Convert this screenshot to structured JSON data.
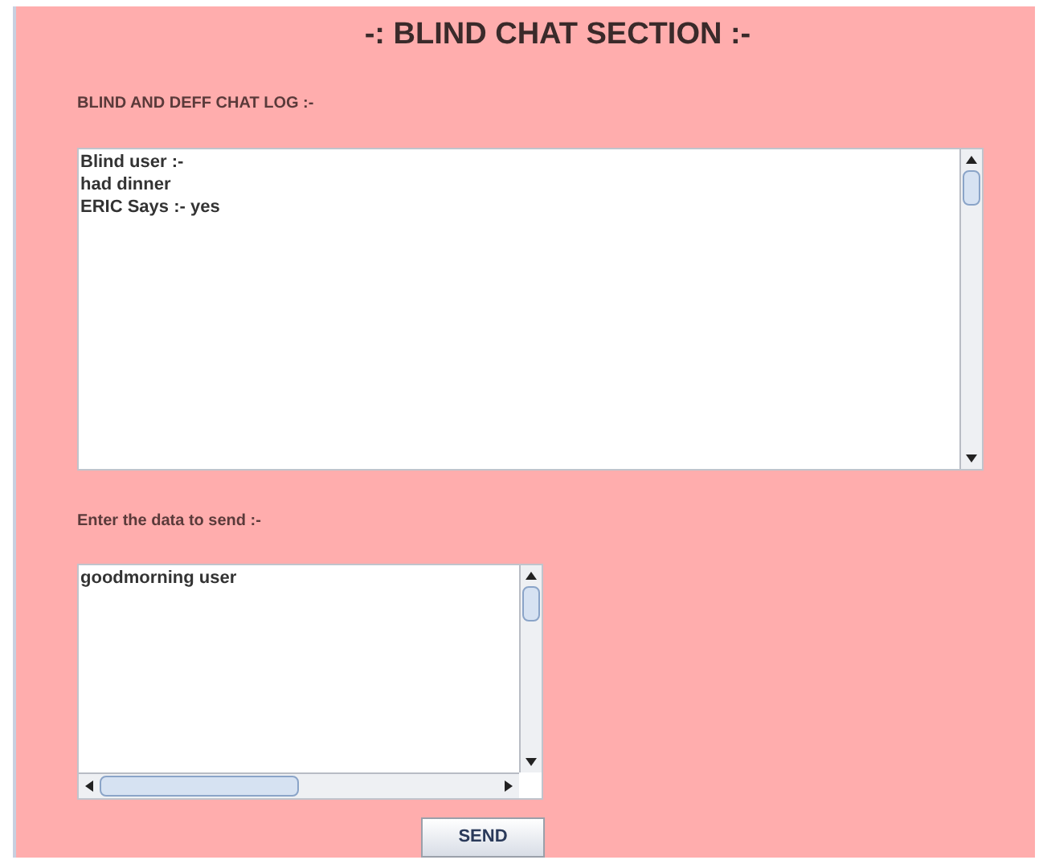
{
  "title": "-: BLIND CHAT SECTION :-",
  "chat_log": {
    "label": "BLIND AND DEFF CHAT LOG :-",
    "lines": [
      "Blind user :-",
      "had dinner",
      "ERIC Says :- yes"
    ]
  },
  "message": {
    "label": "Enter the data to send :-",
    "value": "goodmorning user"
  },
  "send_button": "SEND"
}
